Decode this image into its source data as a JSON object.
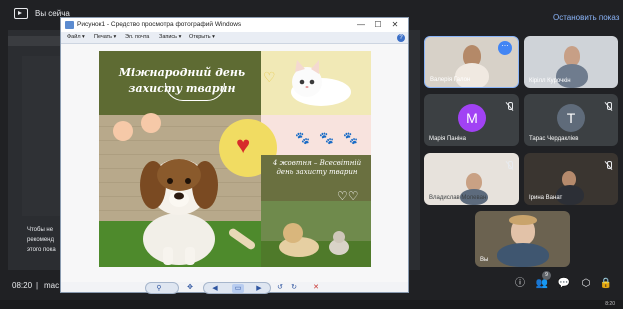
{
  "meet": {
    "present_label": "Вы сейча",
    "stop_presenting": "Остановить показ",
    "time": "08:20",
    "separator": "|",
    "meeting_code": "mac",
    "participants_badge": "9"
  },
  "shared_screen": {
    "side_text_1": "Чтобы не",
    "side_text_2": "рекоменд",
    "side_text_3": "этого пока"
  },
  "viewer": {
    "title": "Рисунок1 - Средство просмотра фотографий Windows",
    "menu": [
      "Файл ▾",
      "Печать ▾",
      "Эл. почта",
      "Запись ▾",
      "Открыть ▾"
    ],
    "help": "?",
    "controls": {
      "minimize": "—",
      "maximize": "☐",
      "close": "✕"
    }
  },
  "poster": {
    "title": "Міжнародний день захисту тварин",
    "date_text": "4 жовтня – Всесвітній день захисту тварин"
  },
  "toolbar": {
    "zoom": "⚲",
    "fit": "✥",
    "prev": "◀",
    "slideshow": "▭",
    "next": "▶",
    "rotate_ccw": "↺",
    "rotate_cw": "↻",
    "delete": "✕"
  },
  "participants": [
    {
      "name": "Валерія Галон"
    },
    {
      "name": "Кірілл Курочкін"
    },
    {
      "name": "Марія Паніна",
      "initial": "M"
    },
    {
      "name": "Тарас Чердакліев",
      "initial": "T"
    },
    {
      "name": "Владислав Молеван"
    },
    {
      "name": "Ірина Ванат"
    },
    {
      "name": "Вы"
    }
  ],
  "taskbar": {
    "clock": "8:20"
  },
  "colors": {
    "meet_bg": "#202124",
    "accent_blue": "#8ab4f8",
    "poster_green": "#5e6b33",
    "avatar_purple": "#a142f4",
    "avatar_slate": "#5f6b7a"
  }
}
